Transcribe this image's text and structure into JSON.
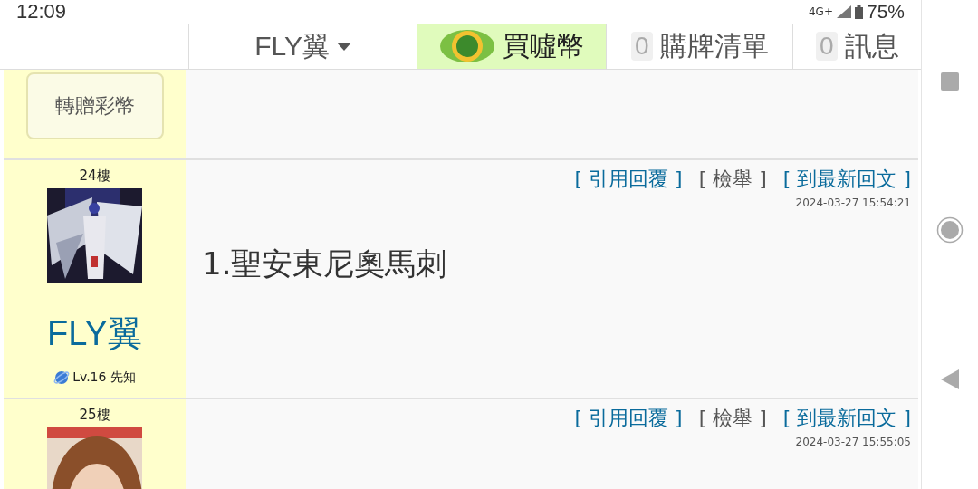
{
  "status_bar": {
    "time": "12:09",
    "network": "4G+",
    "battery": "75%"
  },
  "header": {
    "user_menu": "FLY翼",
    "buy_coins": "買噓幣",
    "cart": {
      "count": "0",
      "label": "購牌清單"
    },
    "messages": {
      "count": "0",
      "label": "訊息"
    }
  },
  "gift_button": "轉贈彩幣",
  "posts": [
    {
      "floor": "24樓",
      "username": "FLY翼",
      "level": "Lv.16 先知",
      "actions": [
        "[ 引用回覆 ]",
        "[ 檢舉 ]",
        "[ 到最新回文 ]"
      ],
      "timestamp": "2024-03-27 15:54:21",
      "body": "1.聖安東尼奧馬刺"
    },
    {
      "floor": "25樓",
      "actions": [
        "[ 引用回覆 ]",
        "[ 檢舉 ]",
        "[ 到最新回文 ]"
      ],
      "timestamp": "2024-03-27 15:55:05"
    }
  ]
}
